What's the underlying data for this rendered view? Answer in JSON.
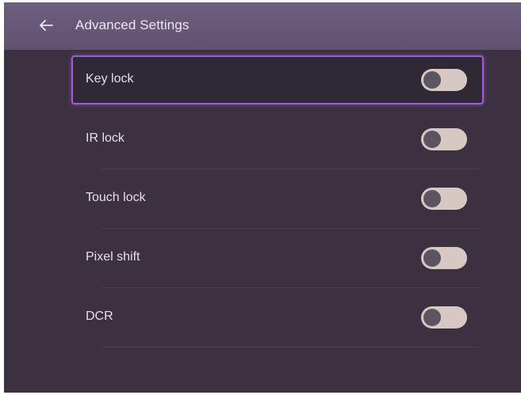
{
  "header": {
    "title": "Advanced Settings",
    "back_icon": "arrow-left-icon"
  },
  "settings": {
    "items": [
      {
        "label": "Key lock",
        "enabled": false,
        "focused": true
      },
      {
        "label": "IR lock",
        "enabled": false,
        "focused": false
      },
      {
        "label": "Touch lock",
        "enabled": false,
        "focused": false
      },
      {
        "label": "Pixel shift",
        "enabled": false,
        "focused": false
      },
      {
        "label": "DCR",
        "enabled": false,
        "focused": false
      }
    ]
  },
  "colors": {
    "background": "#3b3140",
    "header": "#65587a",
    "focus_border": "#a35ad8",
    "toggle_track": "#d8c8c4",
    "toggle_knob": "#5c5460"
  }
}
